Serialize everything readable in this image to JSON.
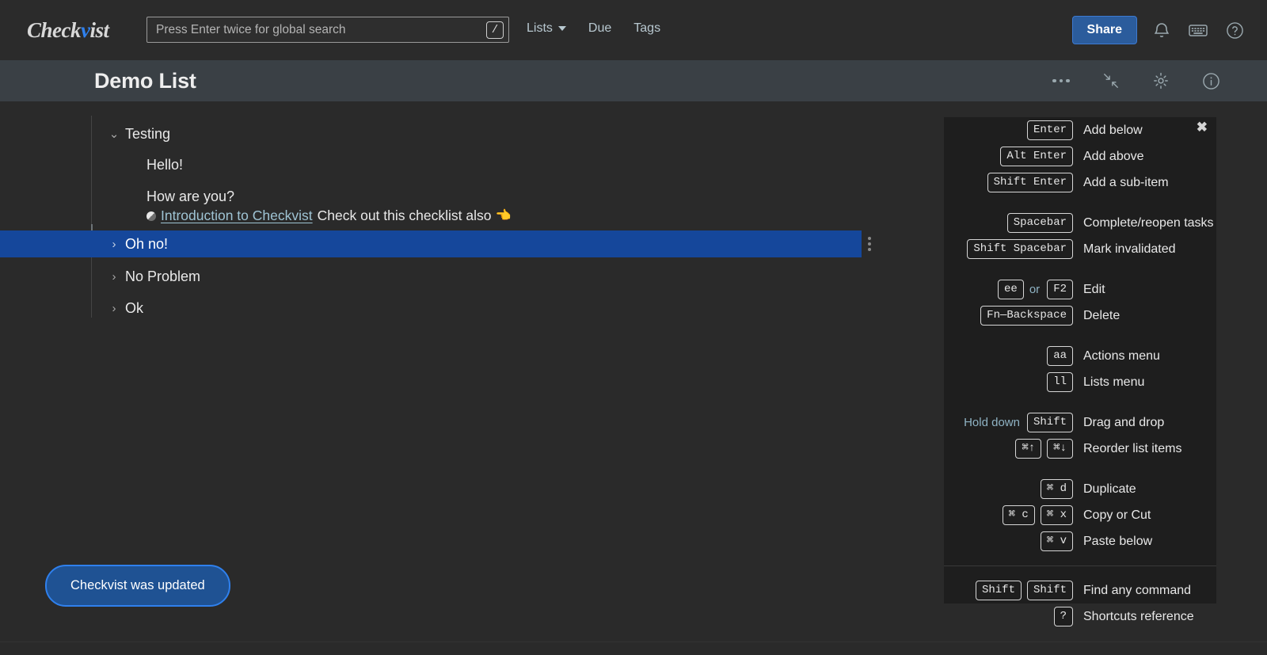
{
  "app": {
    "brand_prefix": "Check",
    "brand_accent_letter": "v",
    "brand_suffix": "ist",
    "accent_color": "#2f80ed",
    "selection_color": "#15479b"
  },
  "search": {
    "placeholder": "Press Enter twice for global search",
    "value": "",
    "shortcut_key": "/"
  },
  "nav": {
    "items": [
      {
        "label": "Lists",
        "has_caret": true
      },
      {
        "label": "Due",
        "has_caret": false
      },
      {
        "label": "Tags",
        "has_caret": false
      }
    ]
  },
  "topbar_actions": {
    "share_label": "Share",
    "icons": [
      "bell-icon",
      "keyboard-icon",
      "help-icon"
    ]
  },
  "list_header": {
    "title": "Demo List",
    "tools": [
      "more-menu-icon",
      "collapse-all-icon",
      "settings-gear-icon",
      "info-icon"
    ]
  },
  "tree": {
    "items": [
      {
        "label": "Testing",
        "chevron": "⌄",
        "expanded": true,
        "selected": false
      },
      {
        "label": "Hello!",
        "chevron": "",
        "expanded": false,
        "selected": false
      },
      {
        "label": "How are you?",
        "chevron": "",
        "expanded": false,
        "selected": false
      },
      {
        "label": "Oh no!",
        "chevron": "›",
        "expanded": false,
        "selected": true
      },
      {
        "label": "No Problem",
        "chevron": "›",
        "expanded": false,
        "selected": false
      },
      {
        "label": "Ok",
        "chevron": "›",
        "expanded": false,
        "selected": false
      }
    ],
    "link_note": {
      "link_text": "Introduction to Checkvist",
      "trailing_text": "Check out this checklist also",
      "emoji": "👈"
    }
  },
  "toast": {
    "message": "Checkvist was updated"
  },
  "shortcuts_panel": {
    "close_label": "✖",
    "groups": [
      {
        "rows": [
          {
            "prefix": "",
            "keys": [
              "Enter"
            ],
            "separator": "",
            "label": "Add below"
          },
          {
            "prefix": "",
            "keys": [
              "Alt Enter"
            ],
            "separator": "",
            "label": "Add above"
          },
          {
            "prefix": "",
            "keys": [
              "Shift Enter"
            ],
            "separator": "",
            "label": "Add a sub-item"
          }
        ]
      },
      {
        "rows": [
          {
            "prefix": "",
            "keys": [
              "Spacebar"
            ],
            "separator": "",
            "label": "Complete/reopen tasks"
          },
          {
            "prefix": "",
            "keys": [
              "Shift Spacebar"
            ],
            "separator": "",
            "label": "Mark invalidated"
          }
        ]
      },
      {
        "rows": [
          {
            "prefix": "",
            "keys": [
              "ee",
              "F2"
            ],
            "separator": "or",
            "label": "Edit"
          },
          {
            "prefix": "",
            "keys": [
              "Fn—Backspace"
            ],
            "separator": "",
            "label": "Delete"
          }
        ]
      },
      {
        "rows": [
          {
            "prefix": "",
            "keys": [
              "aa"
            ],
            "separator": "",
            "label": "Actions menu"
          },
          {
            "prefix": "",
            "keys": [
              "ll"
            ],
            "separator": "",
            "label": "Lists menu"
          }
        ]
      },
      {
        "rows": [
          {
            "prefix": "Hold down",
            "keys": [
              "Shift"
            ],
            "separator": "",
            "label": "Drag and drop"
          },
          {
            "prefix": "",
            "keys": [
              "⌘↑",
              "⌘↓"
            ],
            "separator": "",
            "label": "Reorder list items"
          }
        ]
      },
      {
        "rows": [
          {
            "prefix": "",
            "keys": [
              "⌘ d"
            ],
            "separator": "",
            "label": "Duplicate"
          },
          {
            "prefix": "",
            "keys": [
              "⌘ c",
              "⌘ x"
            ],
            "separator": "",
            "label": "Copy or Cut"
          },
          {
            "prefix": "",
            "keys": [
              "⌘ v"
            ],
            "separator": "",
            "label": "Paste below"
          }
        ]
      },
      {
        "divided": true,
        "rows": [
          {
            "prefix": "",
            "keys": [
              "Shift",
              "Shift"
            ],
            "separator": "",
            "label": "Find any command"
          },
          {
            "prefix": "",
            "keys": [
              "?"
            ],
            "separator": "",
            "label": "Shortcuts reference"
          }
        ]
      }
    ]
  }
}
